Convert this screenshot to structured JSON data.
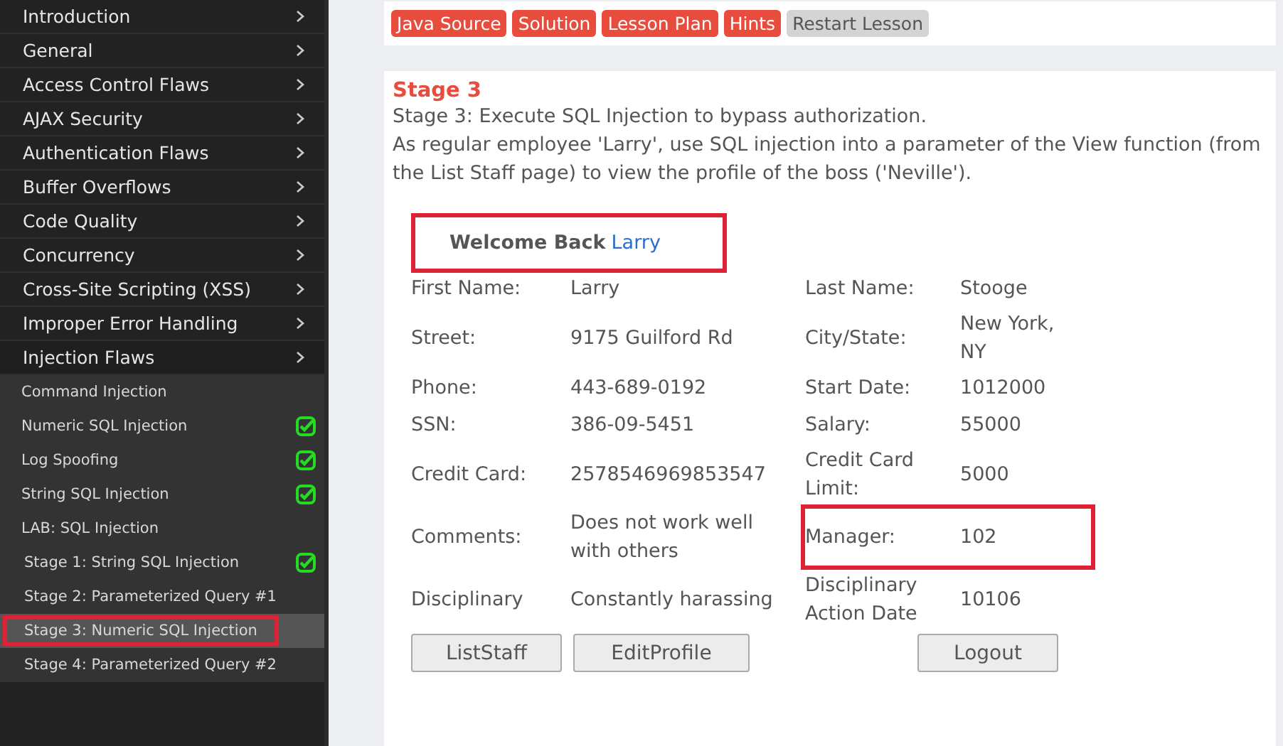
{
  "sidebar": {
    "categories": [
      {
        "label": "Introduction"
      },
      {
        "label": "General"
      },
      {
        "label": "Access Control Flaws"
      },
      {
        "label": "AJAX Security"
      },
      {
        "label": "Authentication Flaws"
      },
      {
        "label": "Buffer Overflows"
      },
      {
        "label": "Code Quality"
      },
      {
        "label": "Concurrency"
      },
      {
        "label": "Cross-Site Scripting (XSS)"
      },
      {
        "label": "Improper Error Handling"
      },
      {
        "label": "Injection Flaws",
        "children": [
          {
            "label": "Command Injection",
            "completed": false,
            "selected": false,
            "highlighted": false
          },
          {
            "label": "Numeric SQL Injection",
            "completed": true,
            "selected": false,
            "highlighted": false
          },
          {
            "label": "Log Spoofing",
            "completed": true,
            "selected": false,
            "highlighted": false
          },
          {
            "label": "String SQL Injection",
            "completed": true,
            "selected": false,
            "highlighted": false
          },
          {
            "label": "LAB: SQL Injection",
            "completed": false,
            "selected": false,
            "highlighted": false,
            "children": [
              {
                "label": "Stage 1: String SQL Injection",
                "completed": true,
                "selected": false,
                "highlighted": false
              },
              {
                "label": "Stage 2: Parameterized Query #1",
                "completed": false,
                "selected": false,
                "highlighted": false
              },
              {
                "label": "Stage 3: Numeric SQL Injection",
                "completed": false,
                "selected": true,
                "highlighted": true
              },
              {
                "label": "Stage 4: Parameterized Query #2",
                "completed": false,
                "selected": false,
                "highlighted": false
              }
            ]
          }
        ]
      }
    ]
  },
  "toolbar": {
    "buttons": [
      {
        "label": "Java Source",
        "kind": "primary"
      },
      {
        "label": "Solution",
        "kind": "primary"
      },
      {
        "label": "Lesson Plan",
        "kind": "primary"
      },
      {
        "label": "Hints",
        "kind": "primary"
      },
      {
        "label": "Restart Lesson",
        "kind": "secondary"
      }
    ]
  },
  "lesson": {
    "title": "Stage 3",
    "description": [
      "Stage 3: Execute SQL Injection to bypass authorization.",
      "As regular employee 'Larry', use SQL injection into a parameter of the View function (from the List Staff page) to view the profile of the boss ('Neville')."
    ],
    "welcome": {
      "text": "Welcome Back",
      "user": "Larry",
      "highlighted": true
    },
    "profile": [
      [
        {
          "label": "First Name:",
          "value": "Larry",
          "highlighted": false
        },
        {
          "label": "Last Name:",
          "value": "Stooge",
          "highlighted": false
        }
      ],
      [
        {
          "label": "Street:",
          "value": "9175 Guilford Rd",
          "highlighted": false
        },
        {
          "label": "City/State:",
          "value": "New York, NY",
          "highlighted": false
        }
      ],
      [
        {
          "label": "Phone:",
          "value": "443-689-0192",
          "highlighted": false
        },
        {
          "label": "Start Date:",
          "value": "1012000",
          "highlighted": false
        }
      ],
      [
        {
          "label": "SSN:",
          "value": "386-09-5451",
          "highlighted": false
        },
        {
          "label": "Salary:",
          "value": "55000",
          "highlighted": false
        }
      ],
      [
        {
          "label": "Credit Card:",
          "value": "2578546969853547",
          "highlighted": false
        },
        {
          "label": "Credit Card Limit:",
          "value": "5000",
          "highlighted": false
        }
      ],
      [
        {
          "label": "Comments:",
          "value": "Does not work well with others",
          "highlighted": false
        },
        {
          "label": "Manager:",
          "value": "102",
          "highlighted": true
        }
      ],
      [
        {
          "label": "Disciplinary",
          "value": "Constantly harassing",
          "highlighted": false
        },
        {
          "label": "Disciplinary Action Date",
          "value": "10106",
          "highlighted": false
        }
      ]
    ],
    "buttons": [
      "ListStaff",
      "EditProfile",
      "Logout"
    ]
  }
}
